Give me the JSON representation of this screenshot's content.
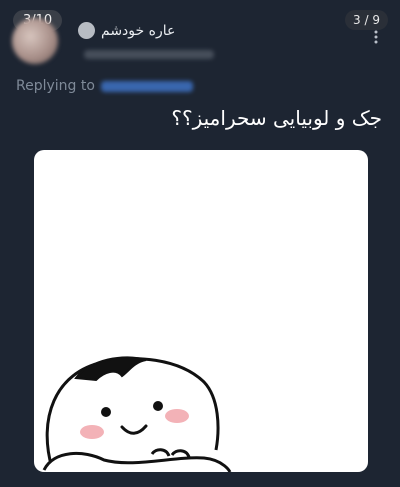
{
  "pager": {
    "left": "3/10",
    "right": "3 / 9"
  },
  "tweet": {
    "display_name": "عاره خودشم",
    "replying_label": "Replying to",
    "text": "جک و لوبیایی سحرامیز؟؟"
  },
  "colors": {
    "background": "#1d2532",
    "mention_blue": "#3e72c4",
    "muted_text": "#7f8a98"
  },
  "icons": [
    "more-vertical-icon",
    "verified-badge-icon"
  ]
}
